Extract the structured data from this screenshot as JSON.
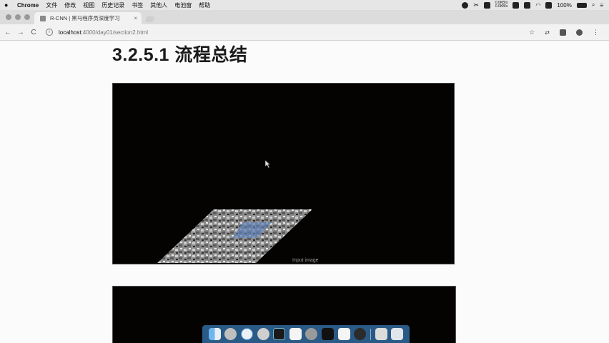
{
  "menubar": {
    "app_name": "Chrome",
    "items": [
      "文件",
      "修改",
      "视图",
      "历史记录",
      "书签",
      "其他人",
      "电池窗",
      "帮助"
    ],
    "battery": "100%",
    "net_up": "0.0KB/s",
    "net_down": "0.0KB/s"
  },
  "tab": {
    "title": "R-CNN | 黑马程序员深度学习",
    "close": "×"
  },
  "toolbar": {
    "back": "←",
    "forward": "→",
    "reload": "C",
    "url_host": "localhost",
    "url_path": ":4000/day01/section2.html",
    "star": "☆"
  },
  "page": {
    "heading": "3.2.5.1 流程总结",
    "video_caption": "Input image"
  },
  "colors": {
    "dock": "#2a5a86",
    "video_bg": "#050202"
  },
  "dock": {
    "icons": [
      "finder-icon",
      "launchpad-icon",
      "safari-icon",
      "chrome-icon",
      "pycharm-icon",
      "preview-icon",
      "system-preferences-icon",
      "terminal-icon",
      "typora-icon",
      "obs-icon",
      "screen-recorder-icon",
      "trash-icon"
    ]
  }
}
